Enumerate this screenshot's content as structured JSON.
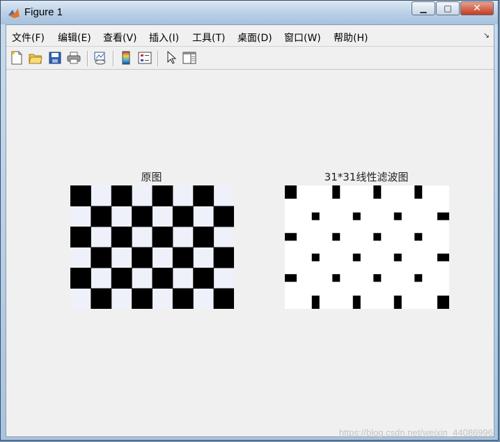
{
  "window": {
    "title": "Figure 1",
    "buttons": {
      "minimize": "▁",
      "maximize": "□",
      "close": "✕"
    }
  },
  "menubar": {
    "items": [
      "文件(F)",
      "编辑(E)",
      "查看(V)",
      "插入(I)",
      "工具(T)",
      "桌面(D)",
      "窗口(W)",
      "帮助(H)"
    ]
  },
  "toolbar": {
    "tools": [
      "new-figure-icon",
      "open-file-icon",
      "save-icon",
      "print-icon",
      "link-plot-icon",
      "colorbar-icon",
      "legend-icon",
      "pointer-icon",
      "property-editor-icon"
    ]
  },
  "figure": {
    "left_axes": {
      "title": "原图",
      "pattern": "checkerboard 8x6"
    },
    "right_axes": {
      "title": "31*31线性滤波图",
      "pattern": "filtered checkerboard"
    },
    "colors": {
      "dark": "#000000",
      "light": "#eef1fa",
      "white": "#ffffff"
    }
  },
  "watermark": "https://blog.csdn.net/weixin_44086996"
}
